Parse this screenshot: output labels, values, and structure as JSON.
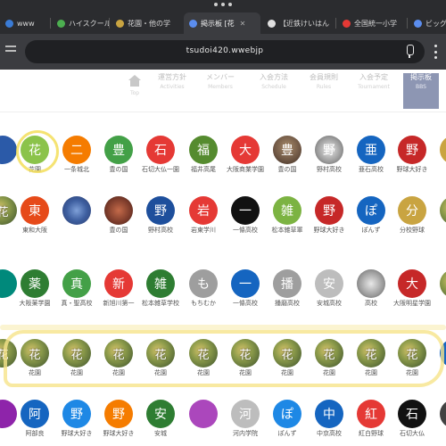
{
  "browser": {
    "tabs": [
      {
        "label": "www",
        "fav": "#3a7bd5",
        "active": false
      },
      {
        "label": "ハイスクール",
        "fav": "#4caf50",
        "active": false
      },
      {
        "label": "花園・他の学",
        "fav": "#c9a441",
        "active": false
      },
      {
        "label": "掲示板 [花",
        "fav": "#5b8dee",
        "active": true
      },
      {
        "label": "【近鉄けいはん",
        "fav": "#e0e0e0",
        "active": false
      },
      {
        "label": "全国統一小学",
        "fav": "#e53935",
        "active": false
      },
      {
        "label": "ビッグ",
        "fav": "#5b8dee",
        "active": false
      }
    ],
    "url": "tsudoi420.wwebjp"
  },
  "nav": {
    "items": [
      {
        "label": "",
        "sub": "Top",
        "icon": "home-icon"
      },
      {
        "label": "運営方針",
        "sub": "Activities"
      },
      {
        "label": "メンバー",
        "sub": "Members"
      },
      {
        "label": "入会方法",
        "sub": "Schedule"
      },
      {
        "label": "会員規則",
        "sub": "Rules"
      },
      {
        "label": "入会予定",
        "sub": "Tournament"
      },
      {
        "label": "掲示板",
        "sub": "BBS",
        "active": true
      }
    ]
  },
  "grid": {
    "rows": [
      [
        {
          "char": "",
          "color": "#2b5aa8",
          "label": ""
        },
        {
          "char": "花",
          "color": "#8bc34a",
          "label": "花園"
        },
        {
          "char": "二",
          "color": "#f57c00",
          "label": "一条城北"
        },
        {
          "char": "豊",
          "color": "#43a047",
          "label": "豊の国"
        },
        {
          "char": "石",
          "color": "#e53935",
          "label": "石切大仏一園"
        },
        {
          "char": "福",
          "color": "#558b2f",
          "label": "福井高尾"
        },
        {
          "char": "大",
          "color": "#e53935",
          "label": "大阪商業学園"
        },
        {
          "char": "豊",
          "color": "photo2",
          "label": "豊の国"
        },
        {
          "char": "野",
          "color": "photo3",
          "label": "野村高校"
        },
        {
          "char": "亜",
          "color": "#1565c0",
          "label": "亜石高校"
        },
        {
          "char": "野",
          "color": "#c62828",
          "label": "野球大好き"
        },
        {
          "char": "",
          "color": "#c9a441",
          "label": ""
        }
      ],
      [
        {
          "char": "",
          "color": "photo",
          "label": ""
        },
        {
          "char": "東",
          "color": "#e64a19",
          "label": "東和大阪"
        },
        {
          "char": "",
          "color": "photo4",
          "label": ""
        },
        {
          "char": "",
          "color": "photo5",
          "label": "豊の国"
        },
        {
          "char": "野",
          "color": "#1e4f9c",
          "label": "野村高校"
        },
        {
          "char": "岩",
          "color": "#e53935",
          "label": "岩東学川"
        },
        {
          "char": "一",
          "color": "#111111",
          "label": "一條高校"
        },
        {
          "char": "雑",
          "color": "#7cb342",
          "label": "松本雑草軍"
        },
        {
          "char": "野",
          "color": "#c62828",
          "label": "野球大好き"
        },
        {
          "char": "ぽ",
          "color": "#1565c0",
          "label": "ぽんず"
        },
        {
          "char": "分",
          "color": "#c9a441",
          "label": "分校野球"
        },
        {
          "char": "",
          "color": "photo",
          "label": ""
        }
      ],
      [
        {
          "char": "",
          "color": "#00897b",
          "label": ""
        },
        {
          "char": "薬",
          "color": "#2e7d32",
          "label": "大阪薬学園"
        },
        {
          "char": "真",
          "color": "#43a047",
          "label": "真・聖高校"
        },
        {
          "char": "新",
          "color": "#e53935",
          "label": "新旭川第一"
        },
        {
          "char": "雑",
          "color": "#2e7d32",
          "label": "松本雑草学校"
        },
        {
          "char": "も",
          "color": "#9e9e9e",
          "label": "もちむか"
        },
        {
          "char": "一",
          "color": "#1565c0",
          "label": "一條高校"
        },
        {
          "char": "播",
          "color": "#9e9e9e",
          "label": "播磨高校"
        },
        {
          "char": "安",
          "color": "#bdbdbd",
          "label": "安城高校"
        },
        {
          "char": "",
          "color": "photo3",
          "label": "高校"
        },
        {
          "char": "大",
          "color": "#c62828",
          "label": "大阪明星学園"
        },
        {
          "char": "",
          "color": "photo",
          "label": ""
        }
      ],
      [
        {
          "char": "",
          "color": "photo",
          "label": ""
        },
        {
          "char": "",
          "color": "photo",
          "label": "花園"
        },
        {
          "char": "",
          "color": "photo",
          "label": "花園"
        },
        {
          "char": "",
          "color": "photo",
          "label": "花園"
        },
        {
          "char": "",
          "color": "photo",
          "label": "花園"
        },
        {
          "char": "",
          "color": "photo",
          "label": "花園"
        },
        {
          "char": "",
          "color": "photo",
          "label": "花園"
        },
        {
          "char": "",
          "color": "photo",
          "label": "花園"
        },
        {
          "char": "",
          "color": "photo",
          "label": "花園"
        },
        {
          "char": "",
          "color": "photo",
          "label": "花園"
        },
        {
          "char": "",
          "color": "photo",
          "label": "花園"
        },
        {
          "char": "",
          "color": "#1565c0",
          "label": ""
        }
      ],
      [
        {
          "char": "",
          "color": "#8e24aa",
          "label": ""
        },
        {
          "char": "阿",
          "color": "#1565c0",
          "label": "阿部良"
        },
        {
          "char": "野",
          "color": "#1e88e5",
          "label": "野球大好き"
        },
        {
          "char": "野",
          "color": "#f57c00",
          "label": "野球大好き"
        },
        {
          "char": "安",
          "color": "#2e7d32",
          "label": "安城"
        },
        {
          "char": "",
          "color": "#ab47bc",
          "label": ""
        },
        {
          "char": "河",
          "color": "#bdbdbd",
          "label": "河内学院"
        },
        {
          "char": "ぽ",
          "color": "#1e88e5",
          "label": "ぽんず"
        },
        {
          "char": "中",
          "color": "#1565c0",
          "label": "中京高校"
        },
        {
          "char": "紅",
          "color": "#e53935",
          "label": "紅白野球"
        },
        {
          "char": "石",
          "color": "#111111",
          "label": "石切大仏"
        },
        {
          "char": "",
          "color": "#424242",
          "label": ""
        }
      ]
    ]
  }
}
